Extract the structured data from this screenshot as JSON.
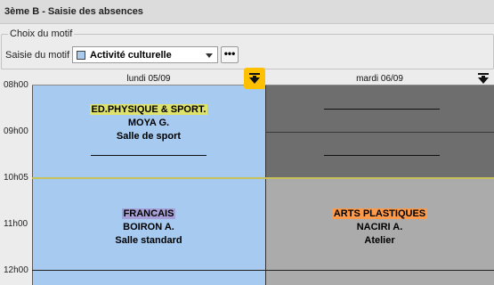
{
  "window": {
    "title": "3ème B - Saisie des absences"
  },
  "motif": {
    "legend": "Choix du motif",
    "label": "Saisie du motif",
    "selected": "Activité culturelle",
    "swatch_color": "#a9cbee",
    "more_label": "•••"
  },
  "hours": [
    "08h00",
    "09h00",
    "10h05",
    "11h00",
    "12h00"
  ],
  "days": [
    {
      "label": "lundi 05/09"
    },
    {
      "label": "mardi 06/09"
    }
  ],
  "courses": {
    "monday_1": {
      "subject": "ED.PHYSIQUE & SPORT.",
      "teacher": "MOYA G.",
      "room": "Salle de sport",
      "tag_color": "#dfe26a"
    },
    "monday_2": {
      "subject": "FRANCAIS",
      "teacher": "BOIRON A.",
      "room": "Salle standard",
      "tag_color": "#a7a0d8"
    },
    "tuesday_2": {
      "subject": "ARTS PLASTIQUES",
      "teacher": "NACIRI A.",
      "room": "Atelier",
      "tag_color": "#ff9a4a"
    }
  },
  "colors": {
    "monday_bg": "#a7caf0",
    "tuesday_busy_bg": "#6e6e6e",
    "tuesday_bg": "#ababab",
    "highlight": "#ffc000",
    "break_line": "#c7c15a"
  },
  "icons": {
    "download": "download-arrow-icon",
    "dropdown": "chevron-down-icon"
  }
}
